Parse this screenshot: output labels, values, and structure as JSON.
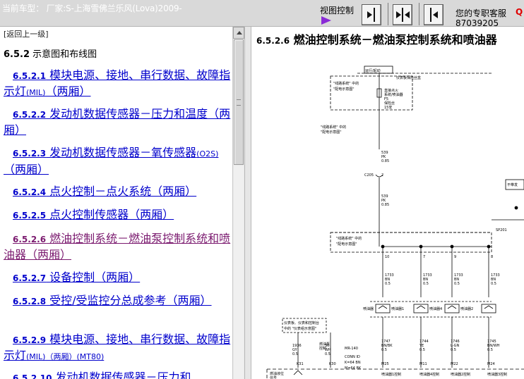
{
  "header": {
    "car_info": "当前车型：  厂家:S-上海雪佛兰乐风(Lova)2009-",
    "view_control": "视图控制",
    "service_label": "您的专职客服",
    "service_q": "Q",
    "phone": "87039205",
    "buttons": [
      "collapse-left",
      "center-split",
      "collapse-right"
    ]
  },
  "nav": {
    "back": "[返回上一级]",
    "section_num": "6.5.2",
    "section_title": " 示意图和布线图",
    "items": [
      {
        "num": "6.5.2.1",
        "text": " 模块电源、接地、串行数据、故障指示灯",
        "suffix": "(MIL)",
        "tail": "（两厢）"
      },
      {
        "num": "6.5.2.2",
        "text": " 发动机数据传感器－压力和温度（两厢）",
        "suffix": "",
        "tail": ""
      },
      {
        "num": "6.5.2.3",
        "text": " 发动机数据传感器－氧传感器",
        "suffix": "(O2S)",
        "tail": "（两厢）"
      },
      {
        "num": "6.5.2.4",
        "text": " 点火控制－点火系统（两厢）",
        "suffix": "",
        "tail": ""
      },
      {
        "num": "6.5.2.5",
        "text": " 点火控制传感器（两厢）",
        "suffix": "",
        "tail": ""
      },
      {
        "num": "6.5.2.6",
        "text": " 燃油控制系统－燃油泵控制系统和喷油器（两厢）",
        "suffix": "",
        "tail": ""
      },
      {
        "num": "6.5.2.7",
        "text": " 设备控制（两厢）",
        "suffix": "",
        "tail": ""
      },
      {
        "num": "6.5.2.8",
        "text": " 受控/受监控分总成参考（两厢）",
        "suffix": "",
        "tail": ""
      },
      {
        "num": "6.5.2.9",
        "text": " 模块电源、接地、串行数据、故障指示灯",
        "suffix": "(MIL)",
        "tail": "（两厢）(MT80)"
      },
      {
        "num": "6.5.2.10",
        "text": " 发动机数据传感器－压力和",
        "suffix": "",
        "tail": ""
      }
    ]
  },
  "document": {
    "title_num": "6.5.2.6",
    "title_text": " 燃油控制系统－燃油泵控制系统和喷油器"
  },
  "diagram": {
    "run_start": "运行/起动",
    "fuse_box": "仪表板保险丝盒",
    "ref_line_sys_1": "\"线路系统\" 中的",
    "ref_power_dist": "\"配电示意图\"",
    "fuse_label_1": "直接点火",
    "fuse_label_2": "系统/喷油器",
    "fuse_label_3": "F5",
    "fuse_label_4": "保险丝",
    "fuse_label_5": "15安",
    "wire_539_a": [
      "539",
      "PK",
      "0.85"
    ],
    "connector_c205": "C205",
    "pin_2": "2",
    "wire_539_b": [
      "539",
      "PK",
      "0.85"
    ],
    "not_used": "不带发",
    "sp201": "SP201",
    "ref_ground": "\"线路系统\" 中的",
    "ref_ground_2": "\"配电示意图\"",
    "pins": [
      "10",
      "7",
      "9",
      "8"
    ],
    "wires_1733": [
      [
        "1733",
        "BN",
        "0.5"
      ],
      [
        "1733",
        "BN",
        "0.5"
      ],
      [
        "1733",
        "BN",
        "0.5"
      ],
      [
        "1733",
        "BN",
        "0.5"
      ]
    ],
    "injectors": [
      "喷油器1",
      "喷油器4",
      "喷油器2"
    ],
    "injector_label": "喷油器",
    "ref_panel": [
      "仪表板、仪表和控制台",
      "中的 \"仪表组示意图\""
    ],
    "wire_1936": [
      "1936",
      "GY",
      "0.5"
    ],
    "wire_30": [
      "30",
      "WH",
      "0.5"
    ],
    "k31": "K31",
    "k30": "K30",
    "wires_174x": [
      [
        "1747",
        "BN/BK",
        "0.5"
      ],
      [
        "1744",
        "YE",
        "0.5"
      ],
      [
        "1746",
        "L-GN",
        "0.5"
      ],
      [
        "1745",
        "BN/WH",
        "0.5"
      ]
    ],
    "m_pins": [
      "M25",
      "M11",
      "M22",
      "M24"
    ],
    "mr_label": "MR-140",
    "conn_id": "CONN ID",
    "conn_k": "K=64 BN",
    "conn_m": "M=64 BK",
    "fuel_pump_ctrl": "燃油泵",
    "fuel_pump_ctrl2": "控制",
    "fuel_level": "燃油液位",
    "fuel_level2": "信号",
    "ctrl_labels": [
      "喷油器1控制",
      "喷油器4控制",
      "喷油器2控制",
      "喷油器3控制"
    ]
  }
}
